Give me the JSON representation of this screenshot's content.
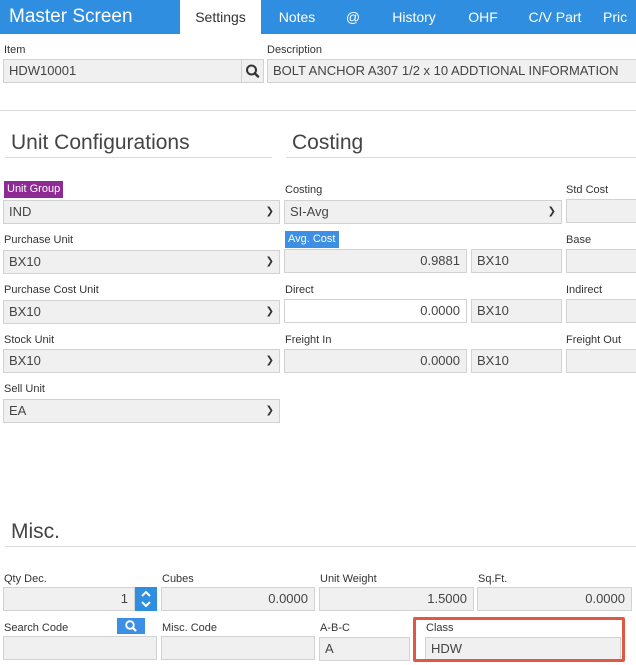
{
  "header": {
    "title": "Master Screen",
    "tabs": [
      "Settings",
      "Notes",
      "@",
      "History",
      "OHF",
      "C/V Part",
      "Pric"
    ]
  },
  "item": {
    "label": "Item",
    "value": "HDW10001"
  },
  "description": {
    "label": "Description",
    "value": "BOLT ANCHOR A307 1/2 x 10 ADDTIONAL INFORMATION"
  },
  "unit_config": {
    "title": "Unit Configurations",
    "unit_group": {
      "label": "Unit Group",
      "value": "IND"
    },
    "purchase_unit": {
      "label": "Purchase Unit",
      "value": "BX10"
    },
    "purchase_cost_unit": {
      "label": "Purchase Cost Unit",
      "value": "BX10"
    },
    "stock_unit": {
      "label": "Stock Unit",
      "value": "BX10"
    },
    "sell_unit": {
      "label": "Sell Unit",
      "value": "EA"
    }
  },
  "costing": {
    "title": "Costing",
    "costing": {
      "label": "Costing",
      "value": "SI-Avg"
    },
    "avg_cost": {
      "label": "Avg. Cost",
      "value": "0.9881",
      "unit": "BX10"
    },
    "direct": {
      "label": "Direct",
      "value": "0.0000",
      "unit": "BX10"
    },
    "freight_in": {
      "label": "Freight In",
      "value": "0.0000",
      "unit": "BX10"
    },
    "std_cost": {
      "label": "Std Cost"
    },
    "base": {
      "label": "Base"
    },
    "indirect": {
      "label": "Indirect"
    },
    "freight_out": {
      "label": "Freight Out"
    }
  },
  "misc": {
    "title": "Misc.",
    "qty_dec": {
      "label": "Qty Dec.",
      "value": "1"
    },
    "cubes": {
      "label": "Cubes",
      "value": "0.0000"
    },
    "unit_weight": {
      "label": "Unit Weight",
      "value": "1.5000"
    },
    "sqft": {
      "label": "Sq.Ft.",
      "value": "0.0000"
    },
    "search_code": {
      "label": "Search Code",
      "value": ""
    },
    "misc_code": {
      "label": "Misc. Code",
      "value": ""
    },
    "abc": {
      "label": "A-B-C",
      "value": "A"
    },
    "class": {
      "label": "Class",
      "value": "HDW"
    }
  },
  "colors": {
    "header": "#2f8ee0",
    "unit_group_badge": "#8e2a93",
    "avg_cost_badge": "#3d8fe6",
    "highlight": "#e05843"
  }
}
